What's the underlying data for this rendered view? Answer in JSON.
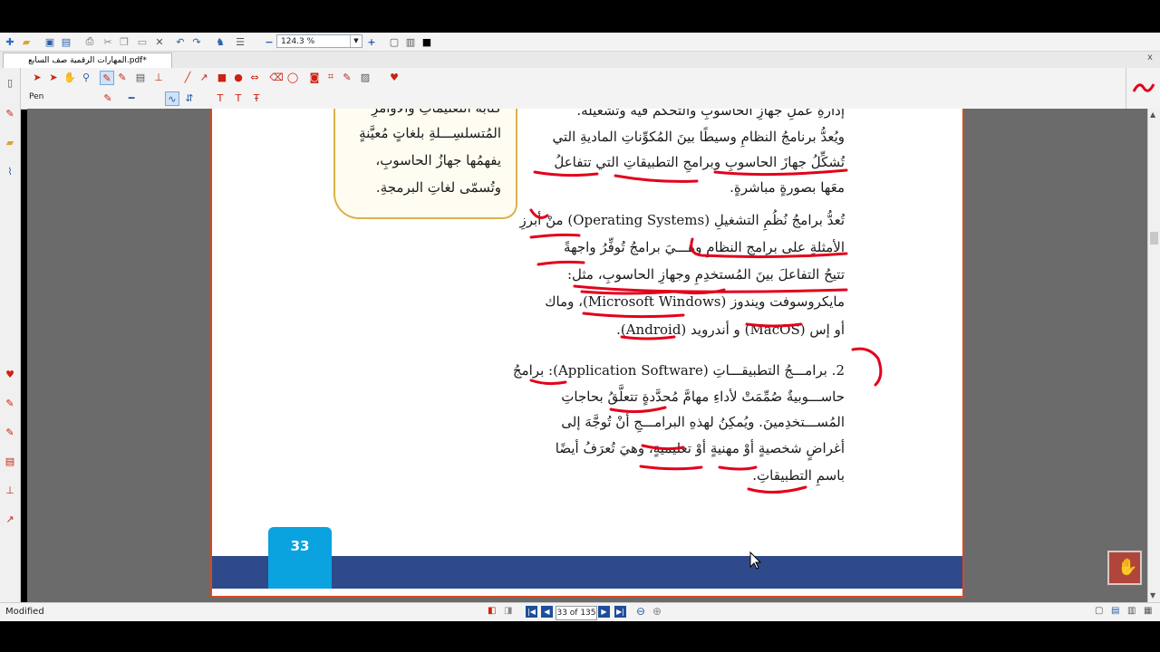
{
  "toolbar": {
    "zoom_value": "124.3 %"
  },
  "tab": {
    "title": "المهارات الرقمية صف السابع.pdf*",
    "close_label": "x"
  },
  "annotation_toolbar": {
    "tool_name": "Pen"
  },
  "document": {
    "callout_lines": [
      "كتابة التعليماتِ والأوامرِ",
      "المُتسلسِـــلةِ بلغاتٍ مُعيَّنةٍ",
      "يفهمُها جهازُ الحاسوبِ،",
      "وتُسمّى لغاتِ البرمجةِ."
    ],
    "para1_lines": [
      "إدارةِ عملِ جهازِ الحاسوبِ والتحكم فيه وتشغيله.",
      "ويُعدُّ برنامجُ النظامِ وسيطًا بينَ المُكوِّناتِ الماديةِ التي",
      "تُشكِّلُ جهازَ الحاسوبِ وبرامجِ التطبيقاتِ التي تتفاعلُ",
      "معَها بصورةٍ مباشرةٍ."
    ],
    "para2_lines": [
      "تُعدُّ برامجُ نُظُمِ التشغيلِ (Operating Systems) منْ أبرزِ",
      "الأمثلةِ على برامجِ النظامِ وهـــيَ برامجُ تُوفِّرُ واجهةً",
      "تتيحُ التفاعلَ بينَ المُستخدِمِ وجهازِ الحاسوبِ، مثل:",
      "مايكروسوفت ويندوز (Microsoft Windows)، وماك",
      "أو إس (MacOS) و أندرويد (Android)."
    ],
    "para3_lines": [
      "2.  برامـــجُ التطبيقـــاتِ (Application Software): برامجُ",
      "حاســـوبيةٌ صُمِّمَتْ لأداءِ مهامَّ مُحدَّدةٍ تتعلَّقُ بحاجاتِ",
      "المُســـتخدِمينَ. ويُمكِنُ لهذهِ البرامـــجِ أنْ تُوجَّهَ إلى",
      "أغراضٍ شخصيةٍ أوْ مهنيةٍ أوْ تعليميةٍ، وهيَ تُعرَفُ أيضًا",
      "باسمِ التطبيقاتِ."
    ],
    "page_number": "33"
  },
  "status": {
    "text": "Modified",
    "page_indicator": "33 of 135"
  },
  "colors": {
    "annotation_red": "#e3001b",
    "page_border": "#d9481f",
    "footer_band": "#2f4a8a",
    "page_number_box": "#0aa3e0"
  }
}
